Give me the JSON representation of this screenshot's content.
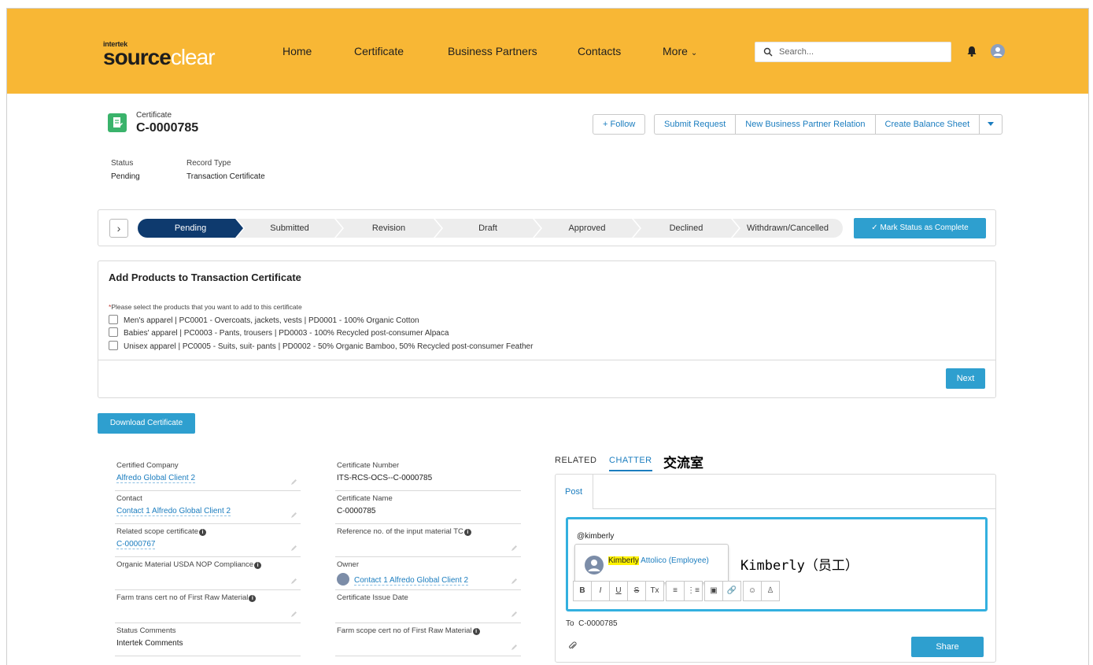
{
  "header": {
    "logo_small": "intertek",
    "logo_part1": "source",
    "logo_part2": "clear",
    "nav": [
      {
        "label": "Home"
      },
      {
        "label": "Certificate"
      },
      {
        "label": "Business Partners"
      },
      {
        "label": "Contacts"
      },
      {
        "label": "More"
      }
    ],
    "search_placeholder": "Search...",
    "brand_color": "#f8b735"
  },
  "record": {
    "object_label": "Certificate",
    "name": "C-0000785",
    "actions": {
      "follow": "+  Follow",
      "submit": "Submit Request",
      "new_relation": "New Business Partner Relation",
      "balance": "Create Balance Sheet"
    },
    "status_label": "Status",
    "status_value": "Pending",
    "record_type_label": "Record Type",
    "record_type_value": "Transaction Certificate"
  },
  "path": {
    "steps": [
      "Pending",
      "Submitted",
      "Revision",
      "Draft",
      "Approved",
      "Declined",
      "Withdrawn/Cancelled"
    ],
    "active_step": "Pending",
    "mark_complete": "✓  Mark Status as Complete"
  },
  "products": {
    "title": "Add Products to Transaction Certificate",
    "hint_req": "*",
    "hint": "Please select the products that you want to add to this certificate",
    "items": [
      "Men's apparel | PC0001 - Overcoats, jackets, vests | PD0001 - 100% Organic Cotton",
      "Babies' apparel | PC0003 - Pants, trousers | PD0003 - 100% Recycled post-consumer Alpaca",
      "Unisex apparel | PC0005 - Suits, suit- pants | PD0002 - 50% Organic Bamboo, 50% Recycled post-consumer Feather"
    ],
    "next": "Next"
  },
  "download": "Download Certificate",
  "details": {
    "left": [
      {
        "label": "Certified Company",
        "value": "Alfredo Global Client 2"
      },
      {
        "label": "Contact",
        "value": "Contact 1 Alfredo Global Client 2"
      },
      {
        "label": "Related scope certificate",
        "value": "C-0000767"
      },
      {
        "label": "Organic Material USDA NOP Compliance",
        "value": ""
      },
      {
        "label": "Farm trans cert no of First Raw Material",
        "value": ""
      },
      {
        "label": "Status Comments",
        "value": "Intertek Comments"
      }
    ],
    "right": [
      {
        "label": "Certificate Number",
        "value": "ITS-RCS-OCS--C-0000785"
      },
      {
        "label": "Certificate Name",
        "value": "C-0000785"
      },
      {
        "label": "Reference no. of the input material TC",
        "value": ""
      },
      {
        "label": "Owner",
        "value": "Contact 1 Alfredo Global Client 2"
      },
      {
        "label": "Certificate Issue Date",
        "value": ""
      },
      {
        "label": "Farm scope cert no of First Raw Material",
        "value": ""
      }
    ]
  },
  "chatter": {
    "tab_related": "RELATED",
    "tab_chatter": "CHATTER",
    "annotation_tab": "交流室",
    "post_tab": "Post",
    "mention_input": "@kimberly",
    "suggestion_highlight": "Kimberly",
    "suggestion_rest": " Attolico (Employee)",
    "annotation_suggestion": "Kimberly（员工）",
    "toolbar": [
      "B",
      "I",
      "U",
      "S",
      "Tx",
      "≡",
      "⋮≡",
      "▣",
      "🔗",
      "☺",
      "♙"
    ],
    "to_label": "To",
    "to_value": "C-0000785",
    "share": "Share"
  }
}
